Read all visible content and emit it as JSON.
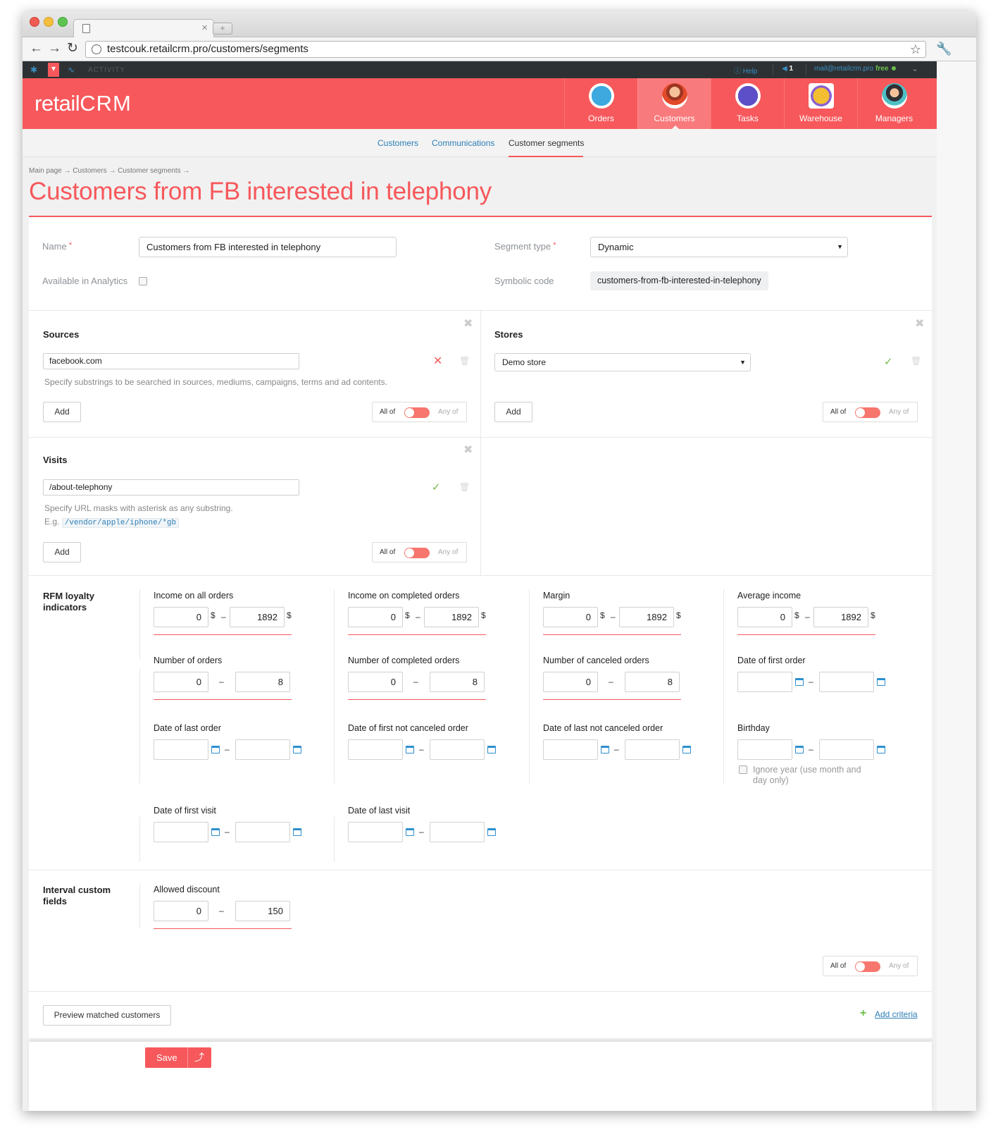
{
  "browser": {
    "url": "testcouk.retailcrm.pro/customers/segments",
    "tab_close": "×",
    "new_tab": "+",
    "back": "←",
    "forward": "→",
    "reload": "↻",
    "star": "☆",
    "wrench": "🔧"
  },
  "topbar": {
    "activity": "ACTIVITY",
    "help": "Help",
    "notifications": "1",
    "email": "mail@retailcrm.pro",
    "plan": "free"
  },
  "header": {
    "logo_left": "retail",
    "logo_right": "CRM",
    "nav": [
      {
        "label": "Orders"
      },
      {
        "label": "Customers"
      },
      {
        "label": "Tasks"
      },
      {
        "label": "Warehouse"
      },
      {
        "label": "Managers"
      }
    ]
  },
  "subnav": {
    "items": [
      {
        "label": "Customers"
      },
      {
        "label": "Communications"
      },
      {
        "label": "Customer segments"
      }
    ]
  },
  "breadcrumb": "Main page → Customers → Customer segments →",
  "page_title": "Customers from FB interested in telephony",
  "form": {
    "name_label": "Name",
    "name_value": "Customers from FB interested in telephony",
    "required_mark": "*",
    "analytics_label": "Available in Analytics",
    "segment_type_label": "Segment type",
    "segment_type_value": "Dynamic",
    "symbolic_code_label": "Symbolic code",
    "symbolic_code_value": "customers-from-fb-interested-in-telephony"
  },
  "sources": {
    "title": "Sources",
    "value": "facebook.com",
    "hint": "Specify substrings to be searched in sources, mediums, campaigns, terms and ad contents.",
    "add": "Add",
    "all_of": "All of",
    "any_of": "Any of"
  },
  "stores": {
    "title": "Stores",
    "value": "Demo store",
    "add": "Add",
    "all_of": "All of",
    "any_of": "Any of"
  },
  "visits": {
    "title": "Visits",
    "value": "/about-telephony",
    "hint": "Specify URL masks with asterisk as any substring.",
    "eg": "E.g.",
    "example": "/vendor/apple/iphone/*gb",
    "add": "Add",
    "all_of": "All of",
    "any_of": "Any of"
  },
  "rfm": {
    "title": "RFM loyalty indicators",
    "currency": "$",
    "dash": "–",
    "income_all": {
      "label": "Income on all orders",
      "from": "0",
      "to": "1892"
    },
    "income_completed": {
      "label": "Income on completed orders",
      "from": "0",
      "to": "1892"
    },
    "margin": {
      "label": "Margin",
      "from": "0",
      "to": "1892"
    },
    "average_income": {
      "label": "Average income",
      "from": "0",
      "to": "1892"
    },
    "num_orders": {
      "label": "Number of orders",
      "from": "0",
      "to": "8"
    },
    "num_completed": {
      "label": "Number of completed orders",
      "from": "0",
      "to": "8"
    },
    "num_canceled": {
      "label": "Number of canceled orders",
      "from": "0",
      "to": "8"
    },
    "date_first_order": {
      "label": "Date of first order"
    },
    "date_last_order": {
      "label": "Date of last order"
    },
    "date_first_not_canceled": {
      "label": "Date of first not canceled order"
    },
    "date_last_not_canceled": {
      "label": "Date of last not canceled order"
    },
    "birthday": {
      "label": "Birthday",
      "ignore_year": "Ignore year (use month and day only)"
    },
    "date_first_visit": {
      "label": "Date of first visit"
    },
    "date_last_visit": {
      "label": "Date of last visit"
    }
  },
  "interval": {
    "title": "Interval custom fields",
    "allowed_discount": {
      "label": "Allowed discount",
      "from": "0",
      "to": "150"
    },
    "all_of": "All of",
    "any_of": "Any of"
  },
  "actions": {
    "preview": "Preview matched customers",
    "add_criteria": "Add criteria",
    "save": "Save"
  },
  "colors": {
    "brand": "#f7585b",
    "link": "#2d7fb6",
    "success": "#79b94b"
  }
}
